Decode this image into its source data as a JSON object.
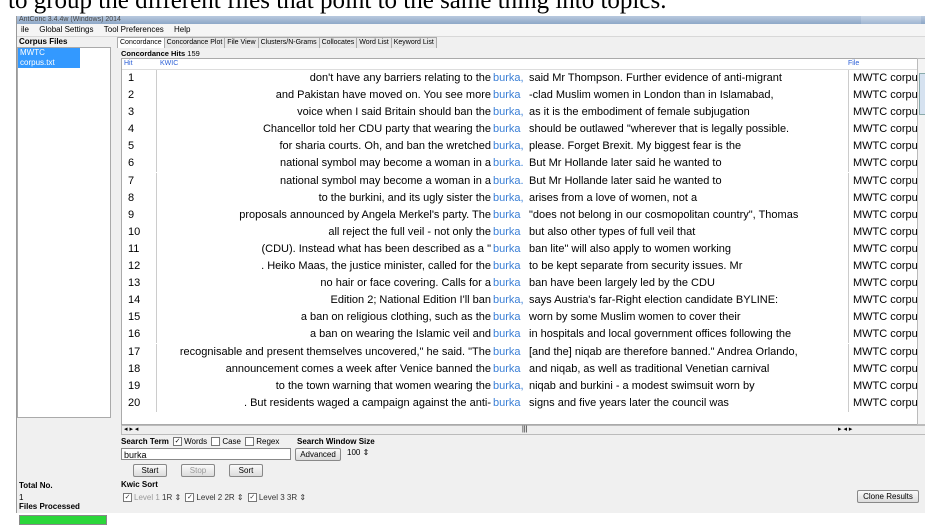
{
  "heading": "to group the different files that point to the same thing into topics.",
  "window": {
    "title": "AntConc 3.4.4w (Windows) 2014",
    "menu": [
      "ile",
      "Global Settings",
      "Tool Preferences",
      "Help"
    ]
  },
  "left_panel": {
    "corpus_files_label": "Corpus Files",
    "corpus_file": "MWTC corpus.txt",
    "total_no_label": "Total No.",
    "total_no_value": "1",
    "files_processed_label": "Files Processed",
    "files_processed_fraction": 1.0
  },
  "tabs": [
    "Concordance",
    "Concordance Plot",
    "File View",
    "Clusters/N-Grams",
    "Collocates",
    "Word List",
    "Keyword List"
  ],
  "concordance": {
    "hits_label": "Concordance Hits",
    "hits_value": "159",
    "col_hit": "Hit",
    "col_kwic": "KWIC",
    "col_file": "File",
    "rows": [
      {
        "n": "1",
        "left": "don't have any barriers relating to the",
        "kw": "burka,",
        "right": "said Mr Thompson. Further evidence of anti-migrant",
        "file": "MWTC corpu"
      },
      {
        "n": "2",
        "left": "and Pakistan have moved on. You see more",
        "kw": "burka",
        "right": "-clad Muslim women in London than in Islamabad,",
        "file": "MWTC corpu"
      },
      {
        "n": "3",
        "left": "voice when I said Britain should ban the",
        "kw": "burka,",
        "right": "as it is the embodiment of female subjugation",
        "file": "MWTC corpu"
      },
      {
        "n": "4",
        "left": "Chancellor told her CDU party that wearing the",
        "kw": "burka",
        "right": "should be outlawed \"wherever that is legally possible.",
        "file": "MWTC corpu"
      },
      {
        "n": "5",
        "left": "for sharia courts. Oh, and ban the wretched",
        "kw": "burka,",
        "right": "please.  Forget Brexit. My biggest fear is the",
        "file": "MWTC corpu"
      },
      {
        "n": "6",
        "left": "national symbol may become a woman in a",
        "kw": "burka.",
        "right": "But Mr Hollande later said he wanted to",
        "file": "MWTC corpu"
      },
      {
        "n": "7",
        "left": "national symbol may become a woman in a",
        "kw": "burka.",
        "right": "But Mr Hollande later said he wanted to",
        "file": "MWTC corpu"
      },
      {
        "n": "8",
        "left": "to the burkini, and its ugly sister the",
        "kw": "burka,",
        "right": "arises from a love of women, not a",
        "file": "MWTC corpu"
      },
      {
        "n": "9",
        "left": "proposals announced by Angela Merkel's party. The",
        "kw": "burka",
        "right": "\"does not belong in our cosmopolitan country\", Thomas",
        "file": "MWTC corpu"
      },
      {
        "n": "10",
        "left": "all reject the full veil - not only the",
        "kw": "burka",
        "right": "but also other types of full veil that",
        "file": "MWTC corpu"
      },
      {
        "n": "11",
        "left": "(CDU). Instead what has been described as a \"",
        "kw": "burka",
        "right": "ban lite\" will also apply to women working",
        "file": "MWTC corpu"
      },
      {
        "n": "12",
        "left": ". Heiko Maas, the justice minister, called for the",
        "kw": "burka",
        "right": "to be kept separate from security issues.  Mr",
        "file": "MWTC corpu"
      },
      {
        "n": "13",
        "left": "no hair or face covering.  Calls for a",
        "kw": "burka",
        "right": "ban have been largely led by the CDU",
        "file": "MWTC corpu"
      },
      {
        "n": "14",
        "left": "Edition 2;                  National Edition  I'll ban",
        "kw": "burka,",
        "right": "says Austria's far-Right election candidate  BYLINE:",
        "file": "MWTC corpu"
      },
      {
        "n": "15",
        "left": "a ban on religious clothing, such as the",
        "kw": "burka",
        "right": "worn by some Muslim women to cover their",
        "file": "MWTC corpu"
      },
      {
        "n": "16",
        "left": "a ban on wearing the Islamic veil and",
        "kw": "burka",
        "right": "in hospitals and local government offices following the",
        "file": "MWTC corpu"
      },
      {
        "n": "17",
        "left": "recognisable and present themselves uncovered,\" he said.  \"The",
        "kw": "burka",
        "right": "[and the] niqab are therefore banned.\"  Andrea Orlando,",
        "file": "MWTC corpu"
      },
      {
        "n": "18",
        "left": "announcement comes a week after Venice banned the",
        "kw": "burka",
        "right": "and niqab, as well as traditional Venetian carnival",
        "file": "MWTC corpu"
      },
      {
        "n": "19",
        "left": "to the town warning that women wearing the",
        "kw": "burka,",
        "right": "niqab and burkini - a modest swimsuit worn by",
        "file": "MWTC corpu"
      },
      {
        "n": "20",
        "left": ". But residents waged a campaign against the anti-",
        "kw": "burka",
        "right": "signs and five years later the council was",
        "file": "MWTC corpu"
      }
    ]
  },
  "search": {
    "term_label": "Search Term",
    "words_label": "Words",
    "case_label": "Case",
    "regex_label": "Regex",
    "window_size_label": "Search Window Size",
    "term_value": "burka",
    "window_size_value": "100",
    "advanced_label": "Advanced",
    "start_label": "Start",
    "stop_label": "Stop",
    "sort_label": "Sort"
  },
  "kwic_sort": {
    "label": "Kwic Sort",
    "level1_label": "Level 1",
    "level1_value": "1R",
    "level2_label": "Level 2",
    "level2_value": "2R",
    "level3_label": "Level 3",
    "level3_value": "3R",
    "clone_label": "Clone Results"
  }
}
